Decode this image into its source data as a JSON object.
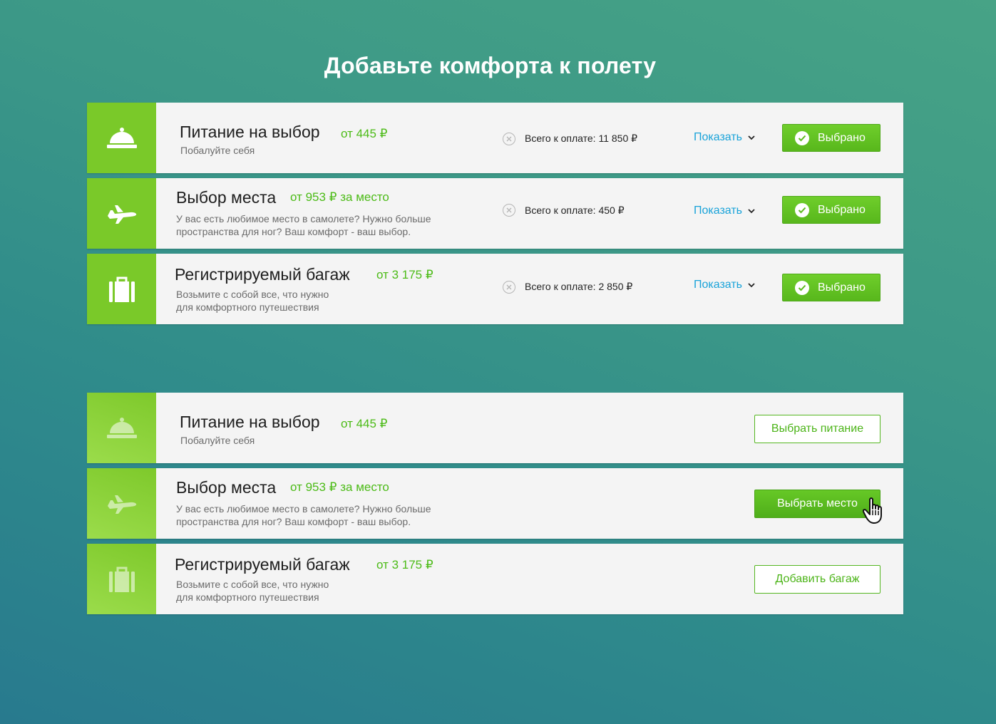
{
  "page": {
    "title": "Добавьте комфорта к полету"
  },
  "selected_section": {
    "items": [
      {
        "id": "food",
        "icon": "cloche-icon",
        "title": "Питание на выбор",
        "price": "от 445 ₽",
        "description": "Побалуйте себя",
        "total": "Всего к оплате: 11 850 ₽",
        "show_label": "Показать",
        "status_label": "Выбрано"
      },
      {
        "id": "seat",
        "icon": "airplane-icon",
        "title": "Выбор места",
        "price": "от 953 ₽ за место",
        "description": "У вас есть любимое место в самолете? Нужно больше пространства для ног? Ваш комфорт - ваш выбор.",
        "total": "Всего к оплате: 450 ₽",
        "show_label": "Показать",
        "status_label": "Выбрано"
      },
      {
        "id": "baggage",
        "icon": "suitcase-icon",
        "title": "Регистрируемый багаж",
        "price": "от 3 175 ₽",
        "description": "Возьмите с собой все, что нужно для комфортного путешествия",
        "total": "Всего к оплате: 2 850 ₽",
        "show_label": "Показать",
        "status_label": "Выбрано"
      }
    ]
  },
  "offer_section": {
    "items": [
      {
        "id": "food",
        "icon": "cloche-icon",
        "title": "Питание на выбор",
        "price": "от 445 ₽",
        "description": "Побалуйте себя",
        "button_label": "Выбрать питание",
        "button_style": "outline"
      },
      {
        "id": "seat",
        "icon": "airplane-icon",
        "title": "Выбор места",
        "price": "от 953 ₽ за место",
        "description": "У вас есть любимое место в самолете? Нужно больше пространства для ног? Ваш комфорт - ваш выбор.",
        "button_label": "Выбрать место",
        "button_style": "solid-hover"
      },
      {
        "id": "baggage",
        "icon": "suitcase-icon",
        "title": "Регистрируемый багаж",
        "price": "от 3 175 ₽",
        "description": "Возьмите с собой все, что нужно для комфортного путешествия",
        "button_label": "Добавить багаж",
        "button_style": "outline"
      }
    ]
  },
  "colors": {
    "accent_green": "#7ac929",
    "price_green": "#4cbb17",
    "link_blue": "#1aa3d9",
    "card_bg": "#f4f4f4"
  }
}
